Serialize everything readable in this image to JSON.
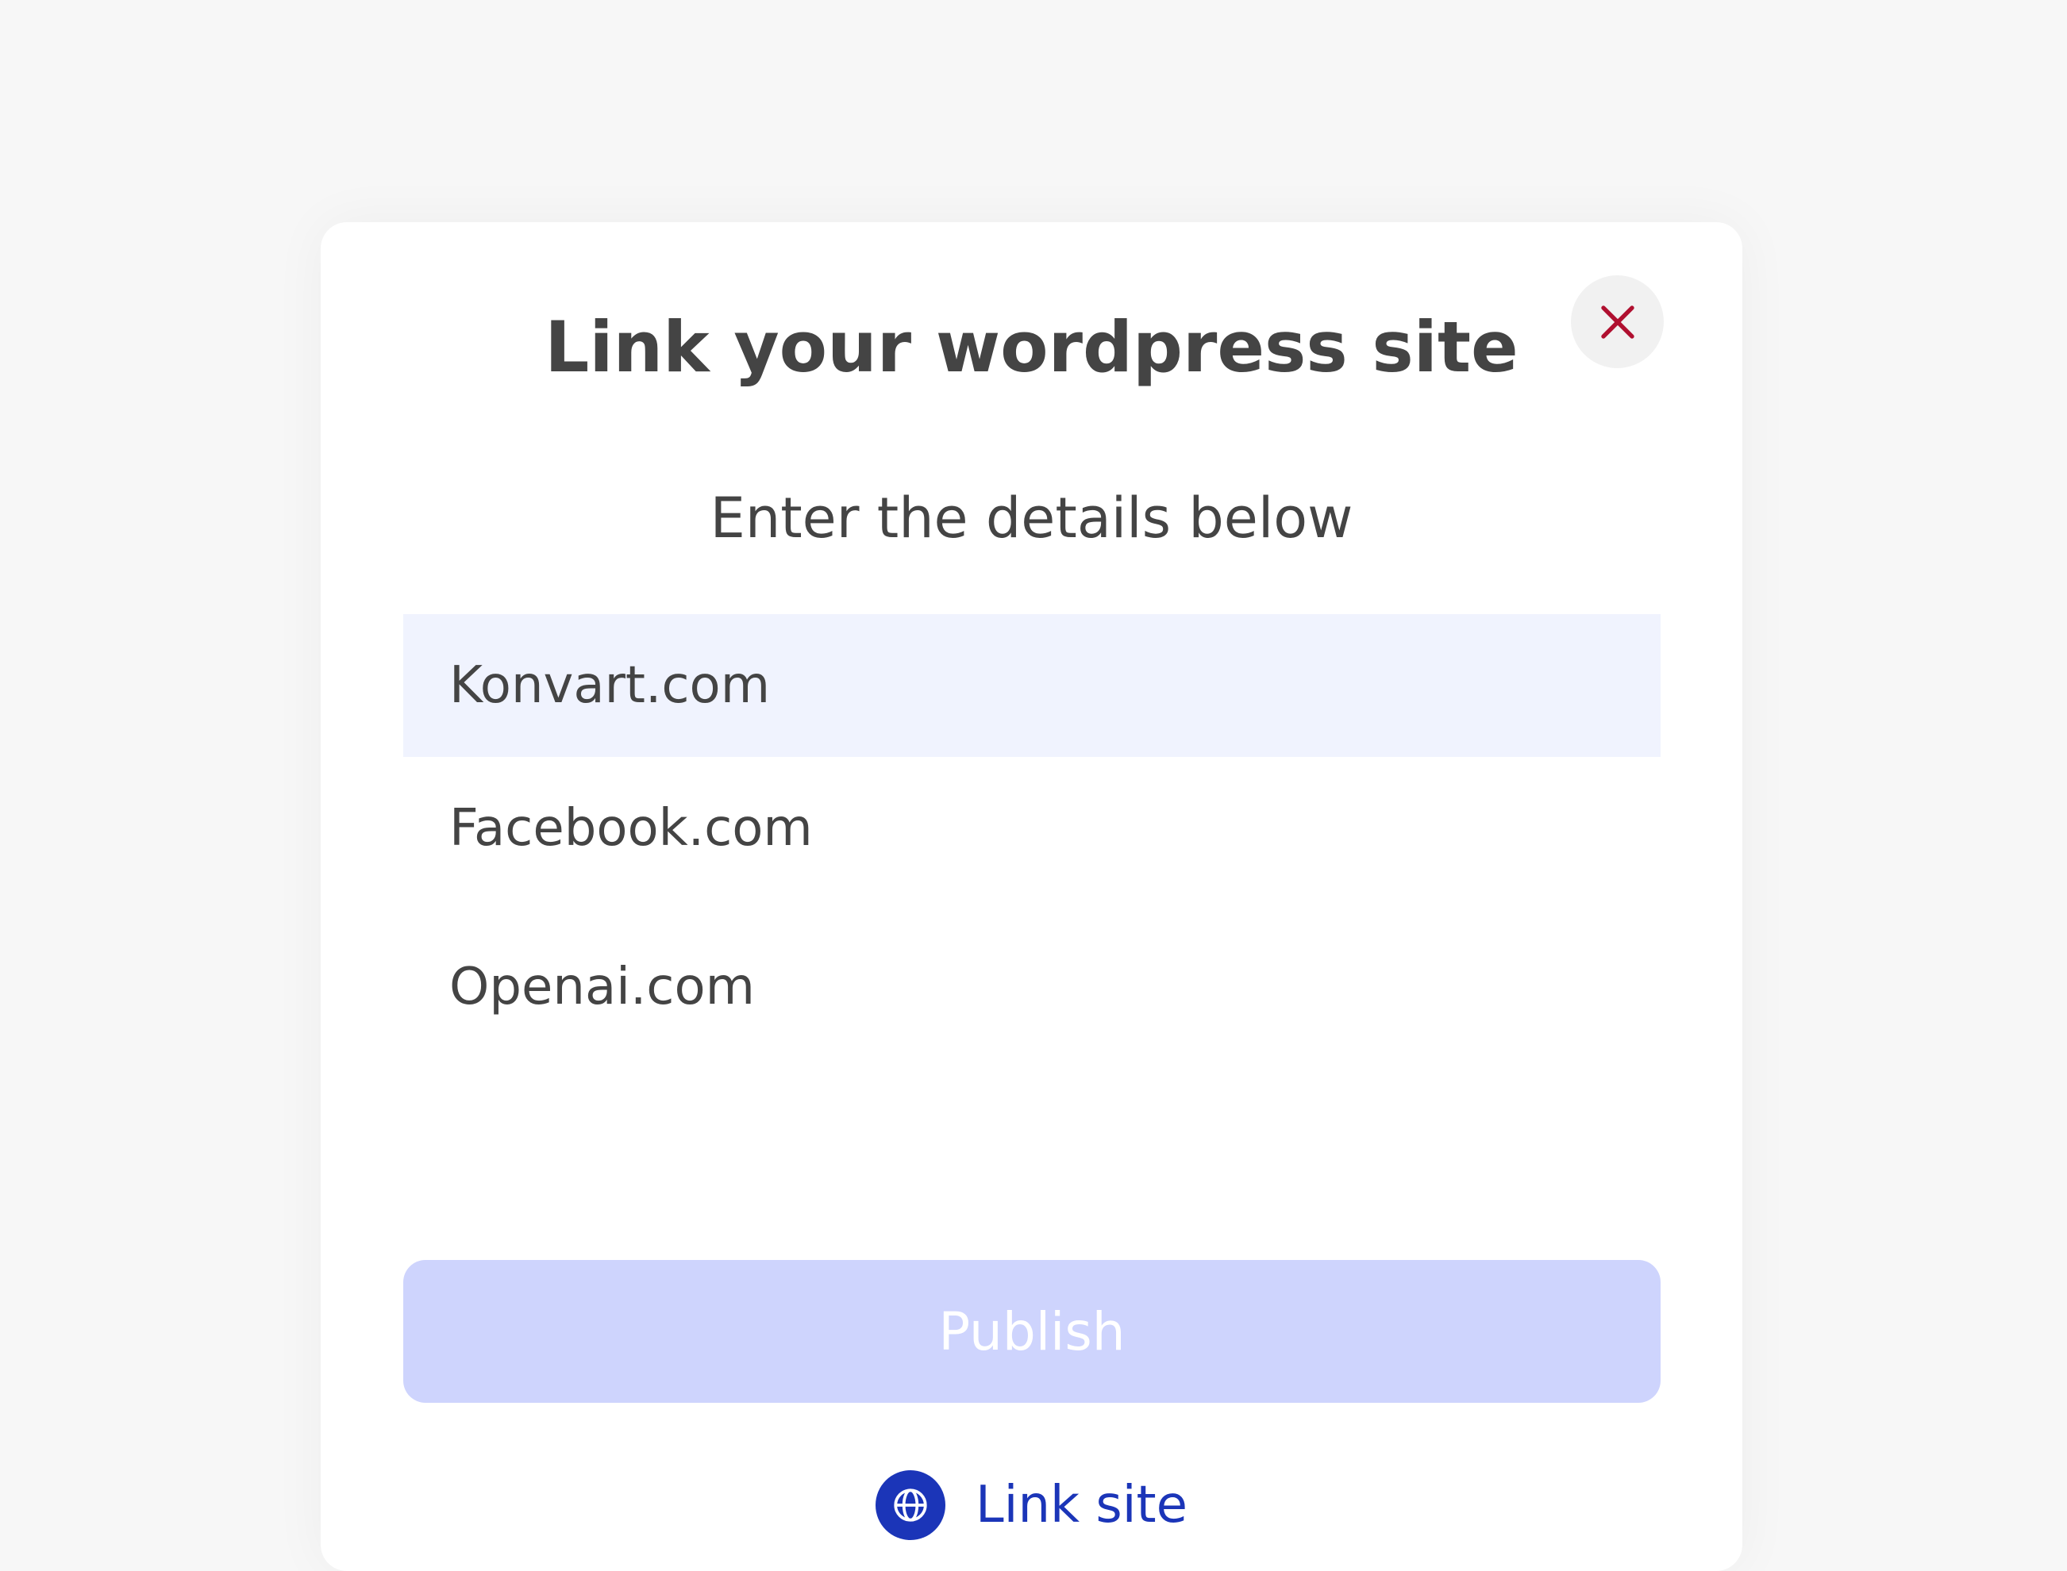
{
  "modal": {
    "title": "Link your wordpress site",
    "subtitle": "Enter the details below",
    "close_icon": "close-icon",
    "sites": [
      {
        "label": "Konvart.com",
        "selected": true
      },
      {
        "label": "Facebook.com",
        "selected": false
      },
      {
        "label": "Openai.com",
        "selected": false
      }
    ],
    "publish_label": "Publish",
    "link_site_label": "Link site",
    "link_site_icon": "globe-icon"
  },
  "colors": {
    "text": "#444444",
    "close_icon": "#b01030",
    "close_bg": "#f1f1f1",
    "selected_row": "#f0f3fe",
    "publish_bg": "#ced4fd",
    "accent": "#1b35b8",
    "page_bg": "#f7f7f7"
  }
}
